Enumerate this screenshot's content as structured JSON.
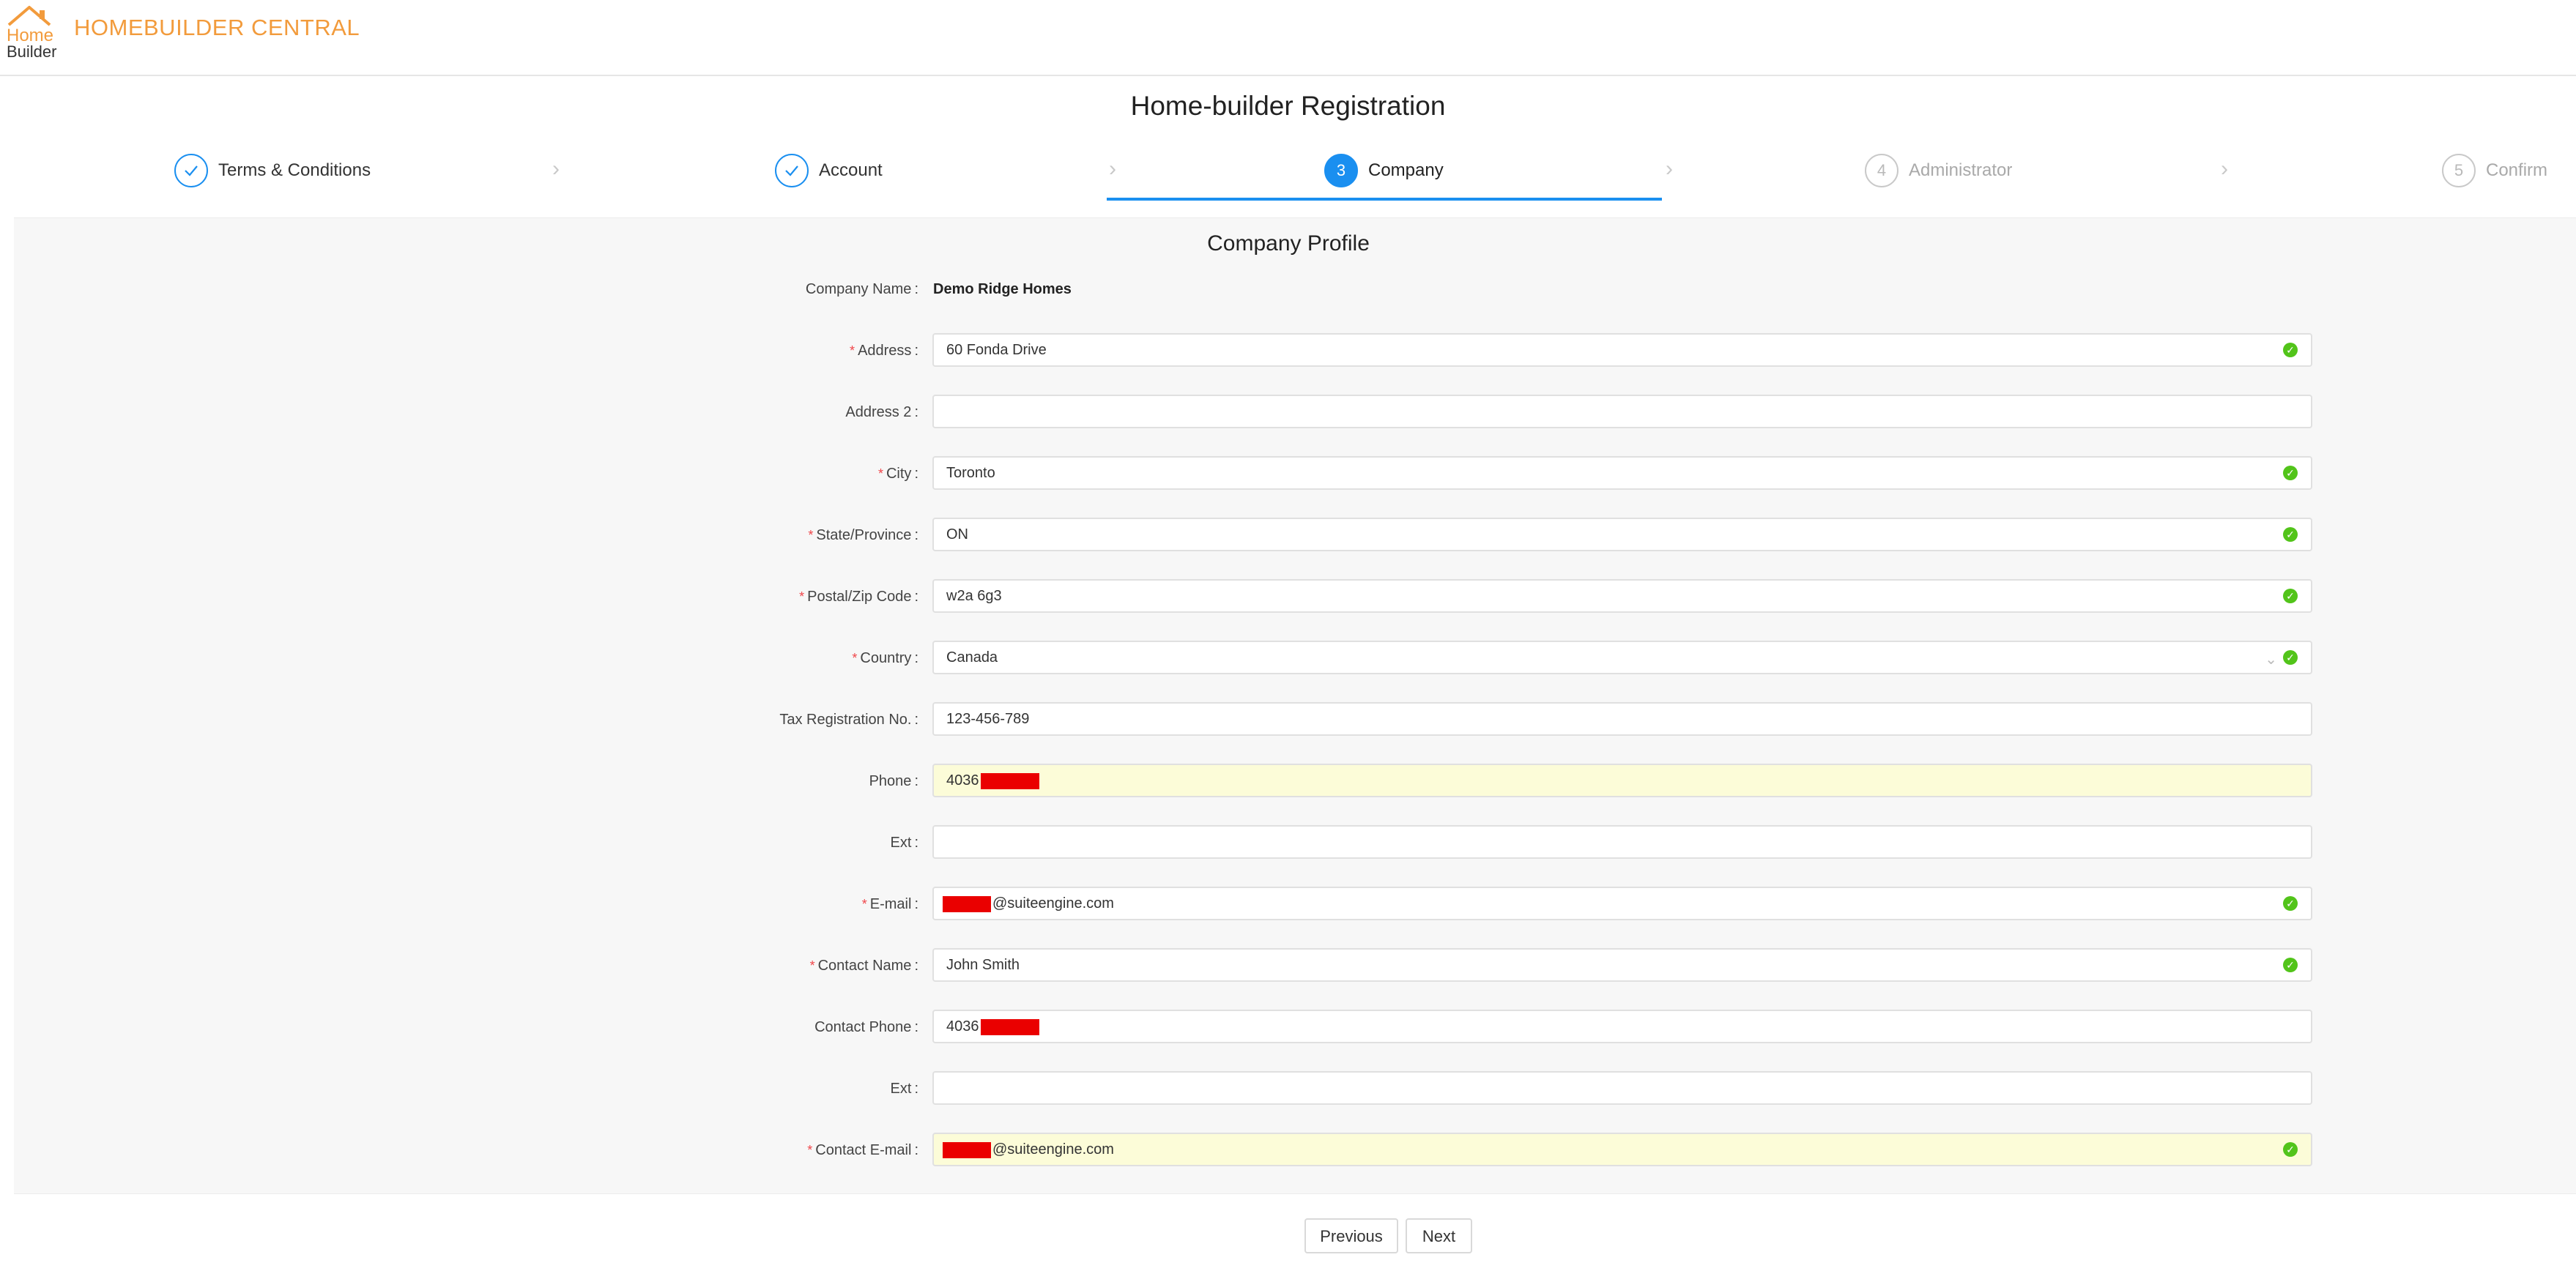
{
  "header": {
    "brand": "HOMEBUILDER CENTRAL",
    "logo_text_top": "Home",
    "logo_text_bottom": "Builder",
    "accent_color": "#f29b3c"
  },
  "page_title": "Home-builder Registration",
  "steps": [
    {
      "label": "Terms & Conditions",
      "status": "done",
      "icon": "check-icon"
    },
    {
      "label": "Account",
      "status": "done",
      "icon": "check-icon"
    },
    {
      "label": "Company",
      "number": "3",
      "status": "active"
    },
    {
      "label": "Administrator",
      "number": "4",
      "status": "wait"
    },
    {
      "label": "Confirm",
      "number": "5",
      "status": "wait"
    }
  ],
  "form": {
    "title": "Company Profile",
    "company_name_label": "Company Name",
    "company_name_value": "Demo Ridge Homes",
    "fields": {
      "address": {
        "label": "Address",
        "value": "60 Fonda Drive",
        "required": true,
        "valid": true
      },
      "address2": {
        "label": "Address 2",
        "value": ""
      },
      "city": {
        "label": "City",
        "value": "Toronto",
        "required": true,
        "valid": true
      },
      "state": {
        "label": "State/Province",
        "value": "ON",
        "required": true,
        "valid": true
      },
      "postal": {
        "label": "Postal/Zip Code",
        "value": "w2a 6g3",
        "required": true,
        "valid": true
      },
      "country": {
        "label": "Country",
        "value": "Canada",
        "required": true,
        "valid": true
      },
      "tax": {
        "label": "Tax Registration No.",
        "value": "123-456-789"
      },
      "phone": {
        "label": "Phone",
        "value_prefix": "4036"
      },
      "ext": {
        "label": "Ext",
        "value": ""
      },
      "email": {
        "label": "E-mail",
        "value_suffix": "@suiteengine.com",
        "required": true,
        "valid": true
      },
      "contact_name": {
        "label": "Contact Name",
        "value": "John Smith",
        "required": true,
        "valid": true
      },
      "contact_phone": {
        "label": "Contact Phone",
        "value_prefix": "4036"
      },
      "contact_ext": {
        "label": "Ext",
        "value": ""
      },
      "contact_email": {
        "label": "Contact E-mail",
        "value_suffix": "@suiteengine.com",
        "required": true,
        "valid": true
      }
    }
  },
  "buttons": {
    "previous": "Previous",
    "next": "Next"
  },
  "colors": {
    "primary": "#1a8ff0",
    "success": "#52c41a",
    "required": "#f0464a",
    "autofill_bg": "#fcfcd8",
    "redaction": "#ea0000"
  }
}
